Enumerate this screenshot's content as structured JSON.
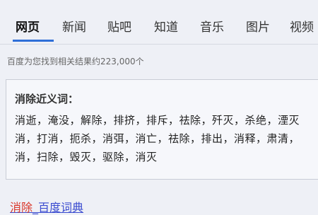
{
  "tabs": [
    "网页",
    "新闻",
    "贴吧",
    "知道",
    "音乐",
    "图片",
    "视频"
  ],
  "result_count": "百度为您找到相关结果约223,000个",
  "card": {
    "title": "消除近义词：",
    "lines": [
      "消逝，淹没，解除，排挤，排斥，祛除，歼灭，杀绝，湮灭",
      "消，打消，扼杀，消弭，消亡，祛除，排出，消释，肃清，",
      "消，扫除，毁灭，驱除，消灭"
    ]
  },
  "link": {
    "keyword": "消除",
    "separator": "_",
    "source": "百度词典"
  },
  "colors": {
    "tab_underline": "#2f6fd8",
    "link": "#3a4bd0",
    "keyword": "#d9362a"
  }
}
